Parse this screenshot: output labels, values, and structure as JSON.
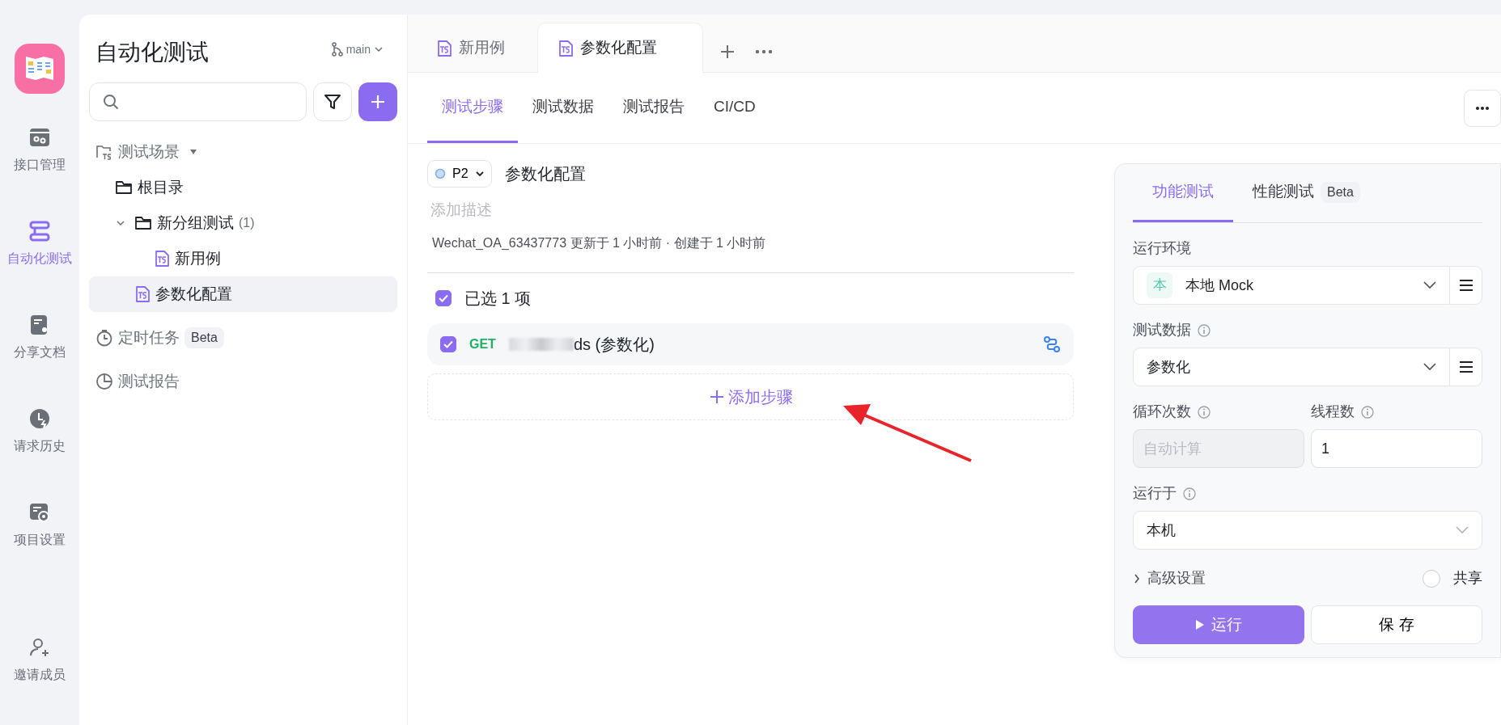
{
  "rail": {
    "items": [
      {
        "label": "接口管理",
        "kind": "api",
        "selected": false
      },
      {
        "label": "自动化测试",
        "kind": "stack",
        "selected": true
      },
      {
        "label": "分享文档",
        "kind": "share",
        "selected": false
      },
      {
        "label": "请求历史",
        "kind": "history",
        "selected": false
      },
      {
        "label": "项目设置",
        "kind": "settings",
        "selected": false
      },
      {
        "label": "邀请成员",
        "kind": "invite",
        "selected": false
      }
    ]
  },
  "sidebar": {
    "title": "自动化测试",
    "branch": "main",
    "tree": [
      {
        "label": "测试场景",
        "kind": "scenario",
        "expanded": true,
        "selected": false,
        "children": [
          {
            "label": "根目录",
            "kind": "folder",
            "selected": false
          },
          {
            "label": "新分组测试",
            "count": "(1)",
            "kind": "folder",
            "expanded": true,
            "selected": false,
            "children": [
              {
                "label": "新用例",
                "kind": "case",
                "selected": false
              }
            ]
          },
          {
            "label": "参数化配置",
            "kind": "case",
            "selected": true
          }
        ]
      },
      {
        "label": "定时任务",
        "badge": "Beta",
        "kind": "timer",
        "selected": false
      },
      {
        "label": "测试报告",
        "kind": "report",
        "selected": false
      }
    ]
  },
  "tabs": [
    {
      "label": "新用例",
      "selected": false
    },
    {
      "label": "参数化配置",
      "selected": true
    }
  ],
  "sub_tabs": [
    {
      "label": "测试步骤",
      "selected": true
    },
    {
      "label": "测试数据",
      "selected": false
    },
    {
      "label": "测试报告",
      "selected": false
    },
    {
      "label": "CI/CD",
      "selected": false
    }
  ],
  "case": {
    "priority": "P2",
    "title": "参数化配置",
    "description_placeholder": "添加描述",
    "meta": "Wechat_OA_63437773 更新于 1 小时前 · 创建于 1 小时前"
  },
  "select_all": {
    "label": "已选 1 项",
    "checked": true
  },
  "steps": [
    {
      "method": "GET",
      "name": "ds (参数化)",
      "checked": true
    }
  ],
  "add_step": "添加步骤",
  "run_panel": {
    "tabs": [
      {
        "label": "功能测试",
        "selected": true
      },
      {
        "label": "性能测试",
        "badge": "Beta",
        "selected": false
      }
    ],
    "environment": {
      "label": "运行环境",
      "tag": "本",
      "value": "本地 Mock"
    },
    "test_data": {
      "label": "测试数据",
      "value": "参数化"
    },
    "loops": {
      "label": "循环次数",
      "placeholder": "自动计算",
      "disabled": true
    },
    "threads": {
      "label": "线程数",
      "value": "1"
    },
    "run_on": {
      "label": "运行于",
      "value": "本机"
    },
    "advanced": {
      "label": "高级设置",
      "expanded": false
    },
    "share": {
      "label": "共享",
      "checked": false
    },
    "run_button": "运行",
    "save_button": "保 存"
  }
}
